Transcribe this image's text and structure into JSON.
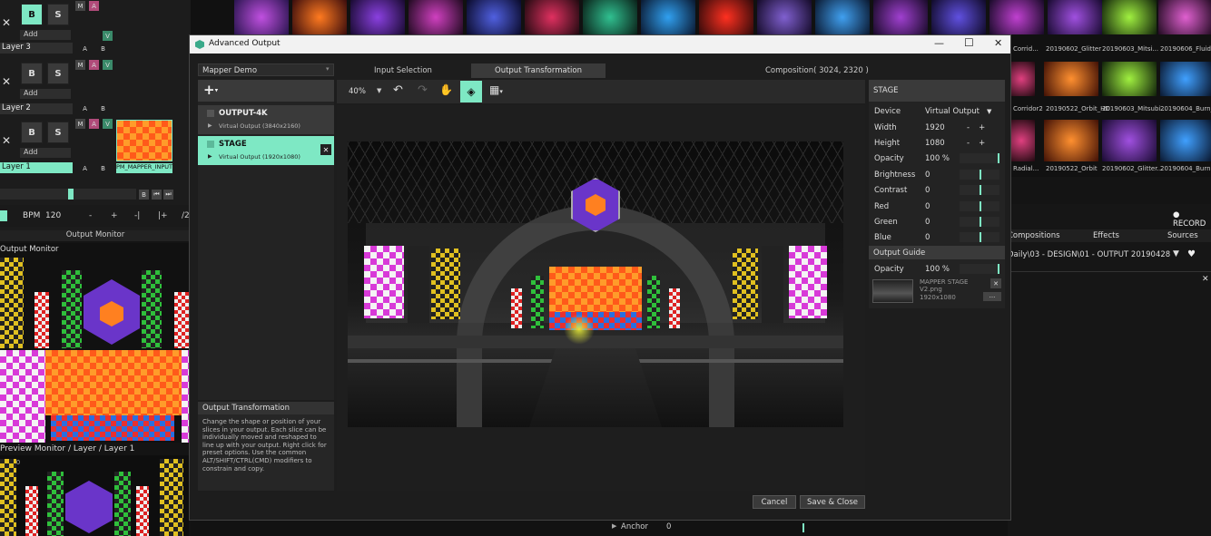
{
  "layers": [
    {
      "b": "B",
      "s": "S",
      "add": "Add",
      "name": "Layer 3"
    },
    {
      "b": "B",
      "s": "S",
      "add": "Add",
      "name": "Layer 2"
    },
    {
      "b": "B",
      "s": "S",
      "add": "Add",
      "name": "Layer 1"
    }
  ],
  "mab": {
    "m": "M",
    "a": "A",
    "v": "V",
    "ab_a": "A",
    "ab_b": "B"
  },
  "clip_label": "PM_MAPPER_INPUT",
  "transport": {
    "b": "B",
    "bpm_label": "BPM",
    "bpm": "120",
    "minus": "-",
    "plus": "+",
    "div": "-|",
    "mul": "|+",
    "half": "/2"
  },
  "output_monitor": "Output Monitor",
  "preview_monitor": "Preview Monitor / Layer / Layer 1",
  "preview_time": "00:10",
  "thumbs_top": [
    "Corrid...",
    "20190602_Glitter",
    "20190603_Mitsi...",
    "20190606_Fluid"
  ],
  "thumbs_mid": [
    "Corridor2",
    "20190522_Orbit_HD",
    "20190603_Mitsubi...",
    "20190604_Burn_HD"
  ],
  "thumbs_bot": [
    "Radial...",
    "20190522_Orbit",
    "20190602_Glitter...",
    "20190604_Burn"
  ],
  "record": "RECORD",
  "tabs_right": {
    "compositions": "Compositions",
    "effects": "Effects",
    "sources": "Sources"
  },
  "path": "20190428 Daily\\03 - DESIGN\\01 - OUTPUT",
  "anchor": {
    "label": "Anchor",
    "value": "0"
  },
  "dialog": {
    "title": "Advanced Output",
    "preset": "Mapper Demo",
    "tab_input": "Input Selection",
    "tab_output": "Output Transformation",
    "composition": "Composition( 3024, 2320 )",
    "zoom": "40%",
    "outputs": [
      {
        "name": "OUTPUT-4K",
        "sub": "Virtual Output (3840x2160)"
      },
      {
        "name": "STAGE",
        "sub": "Virtual Output (1920x1080)"
      }
    ],
    "help_title": "Output Transformation",
    "help_text": "Change the shape or position of your slices in your output. Each slice can be individually moved and reshaped to line up with your output. Right click for preset options. Use the common ALT/SHIFT/CTRL(CMD) modifiers to constrain and copy.",
    "panel_title": "STAGE",
    "device_label": "Device",
    "device": "Virtual Output",
    "width_label": "Width",
    "width": "1920",
    "height_label": "Height",
    "height": "1080",
    "opacity_label": "Opacity",
    "opacity": "100 %",
    "brightness_label": "Brightness",
    "brightness": "0",
    "contrast_label": "Contrast",
    "contrast": "0",
    "red_label": "Red",
    "red": "0",
    "green_label": "Green",
    "green": "0",
    "blue_label": "Blue",
    "blue": "0",
    "guide_title": "Output Guide",
    "guide_opacity_label": "Opacity",
    "guide_opacity": "100 %",
    "guide_file": "MAPPER STAGE V2.png",
    "guide_size": "1920x1080",
    "guide_more": "...",
    "cancel": "Cancel",
    "save": "Save & Close"
  },
  "colors": {
    "accent": "#7ee8c4",
    "bg": "#141414"
  }
}
